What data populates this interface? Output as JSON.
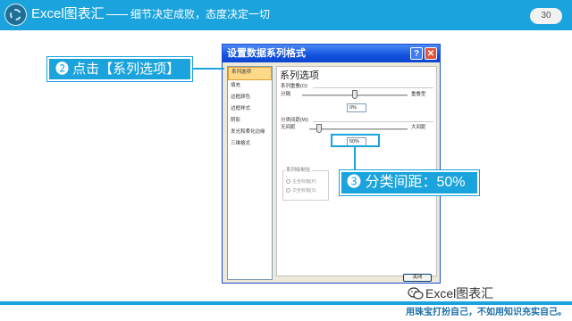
{
  "header": {
    "brand": "Excel图表汇",
    "slogan": "细节决定成败，态度决定一切",
    "page_number": "30"
  },
  "dialog": {
    "title": "设置数据系列格式",
    "help_glyph": "?",
    "close_glyph": "✕",
    "nav_items": [
      "系列选项",
      "填充",
      "边框颜色",
      "边框样式",
      "阴影",
      "发光和柔化边缘",
      "三维格式"
    ],
    "selected_nav": "系列选项",
    "panel": {
      "title": "系列选项",
      "overlap": {
        "label": "系列重叠(O)",
        "min_label": "分隔",
        "max_label": "重叠型",
        "value": "0%",
        "level": 0.5
      },
      "gap": {
        "label": "分类间距(W)",
        "min_label": "无间距",
        "max_label": "大间距",
        "value": "50%",
        "level": 0.1
      },
      "axis_group": {
        "label": "系列绘制在",
        "options": [
          "主坐标轴(P)",
          "次坐标轴(S)"
        ],
        "selected": "主坐标轴(P)"
      }
    },
    "close_button": "关闭"
  },
  "callouts": {
    "step2": "❷ 点击【系列选项】",
    "step3": "❸ 分类间距：50%"
  },
  "footer": {
    "brand": "Excel图表汇",
    "tagline": "用珠宝打扮自己，不如用知识充实自己。"
  },
  "colors": {
    "accent": "#1aa3dc",
    "titlebar": "#1252e0",
    "dialog_bg": "#ece9d8",
    "selected_nav": "#ffd98a"
  }
}
